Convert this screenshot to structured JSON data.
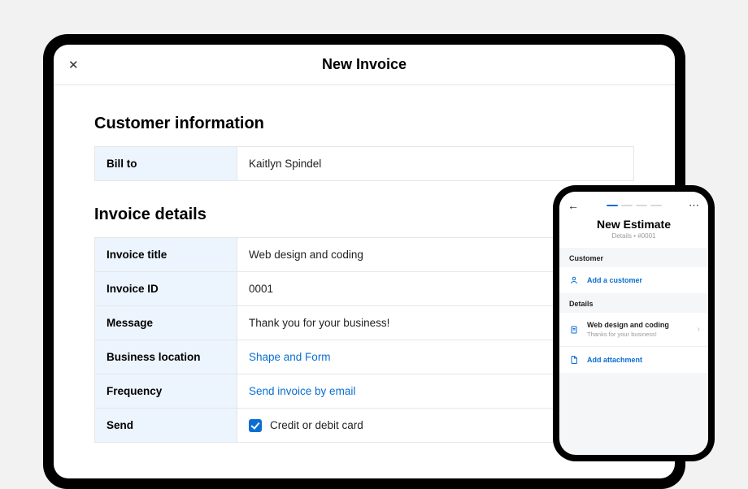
{
  "tablet": {
    "header_title": "New Invoice",
    "section1_title": "Customer information",
    "bill_to_label": "Bill to",
    "bill_to_value": "Kaitlyn Spindel",
    "section2_title": "Invoice details",
    "rows": {
      "invoice_title_label": "Invoice title",
      "invoice_title_value": "Web design and coding",
      "invoice_id_label": "Invoice ID",
      "invoice_id_value": "0001",
      "message_label": "Message",
      "message_value": "Thank you for your business!",
      "business_location_label": "Business location",
      "business_location_value": "Shape and Form",
      "frequency_label": "Frequency",
      "frequency_value": "Send invoice by email",
      "send_label": "Send",
      "send_value": "Credit or debit card"
    }
  },
  "phone": {
    "title": "New Estimate",
    "subtitle": "Details • #0001",
    "customer_header": "Customer",
    "add_customer": "Add a customer",
    "details_header": "Details",
    "detail_primary": "Web design and coding",
    "detail_secondary": "Thanks for your business!",
    "add_attachment": "Add attachment"
  }
}
